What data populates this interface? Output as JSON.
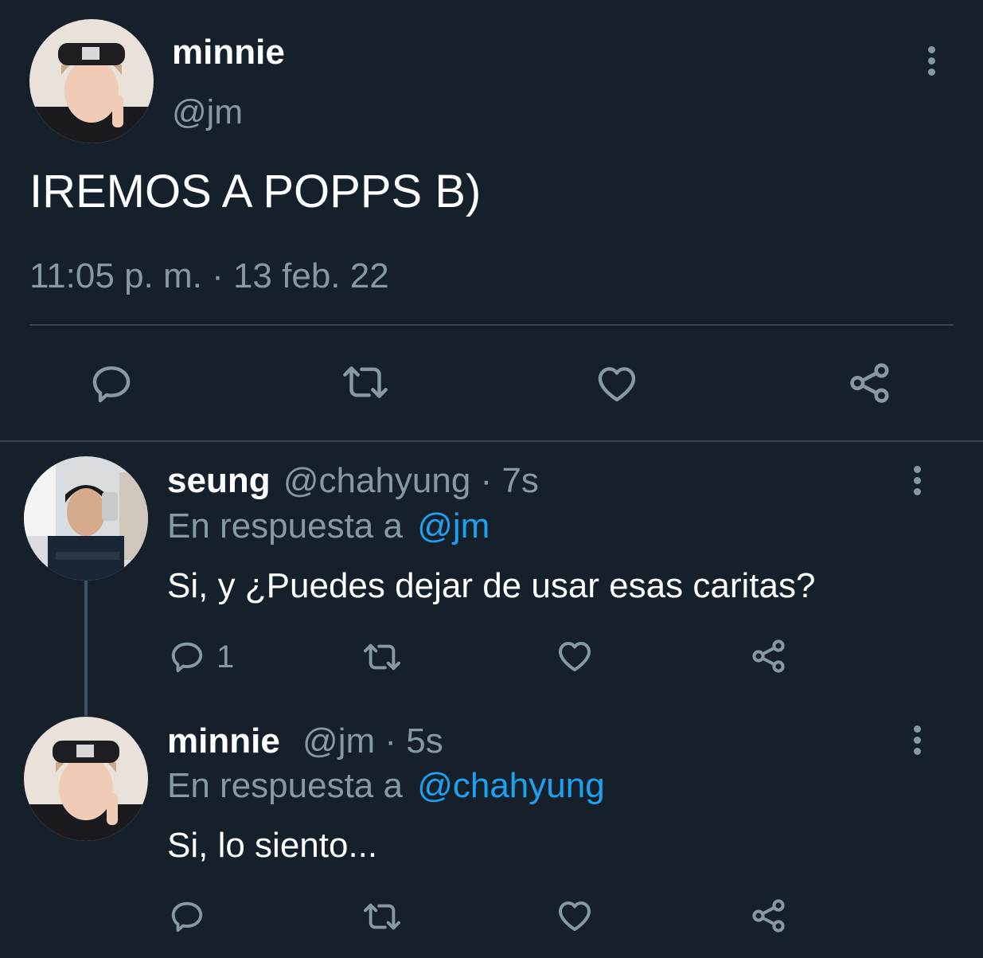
{
  "main_tweet": {
    "display_name": "minnie",
    "handle": "@jm",
    "text": "IREMOS A POPPS B)",
    "timestamp": "11:05 p. m. · 13 feb. 22"
  },
  "replies": [
    {
      "display_name": "seung",
      "handle": "@chahyung",
      "time": "· 7s",
      "reply_prefix": "En respuesta a",
      "reply_to": "@jm",
      "text": "Si, y ¿Puedes dejar de usar esas caritas?",
      "reply_count": "1"
    },
    {
      "display_name": "minnie",
      "handle": "@jm",
      "time": "· 5s",
      "reply_prefix": "En respuesta a",
      "reply_to": "@chahyung",
      "text": "Si, lo siento..."
    }
  ],
  "icons": {
    "reply": "reply-icon",
    "retweet": "retweet-icon",
    "like": "heart-icon",
    "share": "share-icon",
    "more": "more-vertical-icon"
  },
  "colors": {
    "background": "#15202b",
    "link": "#1da1f2",
    "muted": "#8899a6",
    "divider": "#38444d"
  }
}
